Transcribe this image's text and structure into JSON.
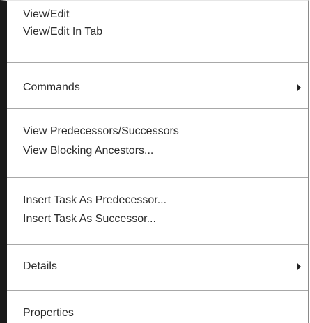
{
  "menu": {
    "groups": [
      {
        "items": [
          {
            "label": "View/Edit"
          },
          {
            "label": "View/Edit In Tab"
          }
        ]
      },
      {
        "items": [
          {
            "label": "Commands",
            "submenu": true,
            "icon": "chevron-right-icon"
          }
        ]
      },
      {
        "items": [
          {
            "label": "View Predecessors/Successors"
          },
          {
            "label": "View Blocking Ancestors..."
          }
        ]
      },
      {
        "items": [
          {
            "label": "Insert Task As Predecessor..."
          },
          {
            "label": "Insert Task As Successor..."
          }
        ]
      },
      {
        "items": [
          {
            "label": "Details",
            "submenu": true,
            "icon": "chevron-right-icon"
          }
        ]
      },
      {
        "items": [
          {
            "label": "Properties"
          }
        ]
      }
    ]
  }
}
